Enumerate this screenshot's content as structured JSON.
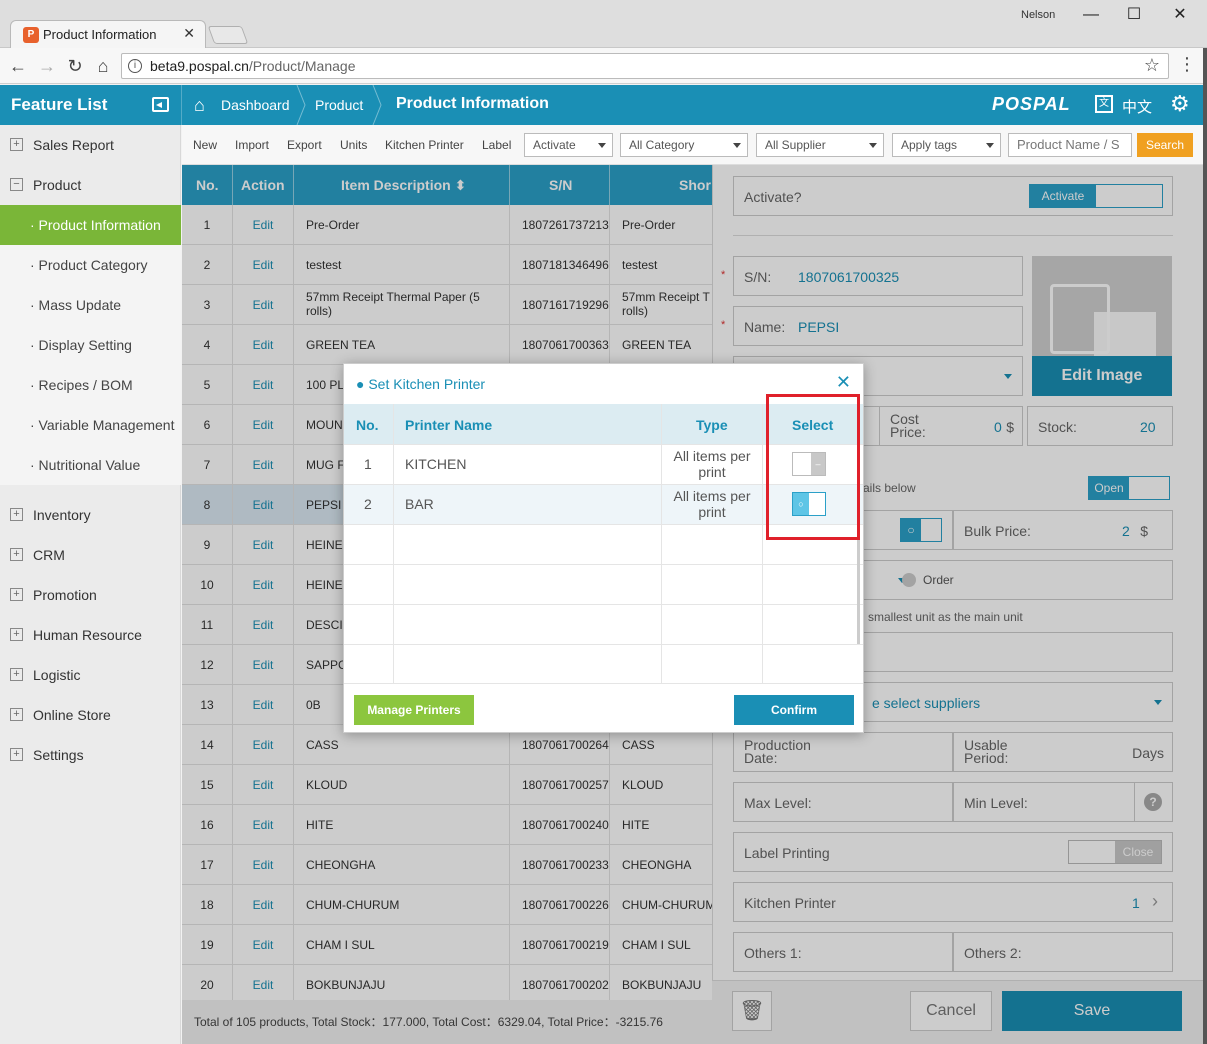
{
  "browser": {
    "tab_title": "Product Information",
    "user": "Nelson",
    "url_host": "beta9.pospal.cn",
    "url_path": "/Product/Manage"
  },
  "header": {
    "feature_list": "Feature List",
    "crumb_dashboard": "Dashboard",
    "crumb_product": "Product",
    "crumb_current": "Product Information",
    "brand": "POSPAL",
    "lang": "中文"
  },
  "sidebar": {
    "items": [
      {
        "label": "Sales Report",
        "mark": "+"
      },
      {
        "label": "Product",
        "mark": "−"
      },
      {
        "label": "Inventory",
        "mark": "+"
      },
      {
        "label": "CRM",
        "mark": "+"
      },
      {
        "label": "Promotion",
        "mark": "+"
      },
      {
        "label": "Human Resource",
        "mark": "+"
      },
      {
        "label": "Logistic",
        "mark": "+"
      },
      {
        "label": "Online Store",
        "mark": "+"
      },
      {
        "label": "Settings",
        "mark": "+"
      }
    ],
    "sub_items": [
      "· Product Information",
      "· Product Category",
      "· Mass Update",
      "· Display Setting",
      "· Recipes / BOM",
      "· Variable Management",
      "· Nutritional Value"
    ]
  },
  "toolbar": {
    "links": [
      "New",
      "Import",
      "Export",
      "Units",
      "Kitchen Printer",
      "Label"
    ],
    "activate_select": "Activate",
    "category_select": "All Category",
    "supplier_select": "All Supplier",
    "tags_select": "Apply tags",
    "search_placeholder": "Product Name / S",
    "search_button": "Search"
  },
  "table": {
    "headers": {
      "no": "No.",
      "action": "Action",
      "desc": "Item Description ⬍",
      "sn": "S/N",
      "short": "Shor"
    },
    "rows": [
      {
        "no": "1",
        "action": "Edit",
        "desc": "Pre-Order",
        "sn": "1807261737213",
        "short": "Pre-Order"
      },
      {
        "no": "2",
        "action": "Edit",
        "desc": "testest",
        "sn": "1807181346496",
        "short": "testest"
      },
      {
        "no": "3",
        "action": "Edit",
        "desc": "57mm Receipt Thermal Paper (5 rolls)",
        "sn": "1807161719296",
        "short": "57mm Receipt T rolls)"
      },
      {
        "no": "4",
        "action": "Edit",
        "desc": "GREEN TEA",
        "sn": "1807061700363",
        "short": "GREEN TEA"
      },
      {
        "no": "5",
        "action": "Edit",
        "desc": "100 PL",
        "sn": "",
        "short": ""
      },
      {
        "no": "6",
        "action": "Edit",
        "desc": "MOUN",
        "sn": "",
        "short": ""
      },
      {
        "no": "7",
        "action": "Edit",
        "desc": "MUG F",
        "sn": "",
        "short": ""
      },
      {
        "no": "8",
        "action": "Edit",
        "desc": "PEPSI",
        "sn": "",
        "short": ""
      },
      {
        "no": "9",
        "action": "Edit",
        "desc": "HEINE",
        "sn": "",
        "short": ""
      },
      {
        "no": "10",
        "action": "Edit",
        "desc": "HEINE",
        "sn": "",
        "short": ""
      },
      {
        "no": "11",
        "action": "Edit",
        "desc": "DESCI",
        "sn": "",
        "short": ""
      },
      {
        "no": "12",
        "action": "Edit",
        "desc": "SAPPC",
        "sn": "",
        "short": ""
      },
      {
        "no": "13",
        "action": "Edit",
        "desc": "0B",
        "sn": "",
        "short": ""
      },
      {
        "no": "14",
        "action": "Edit",
        "desc": "CASS",
        "sn": "1807061700264",
        "short": "CASS"
      },
      {
        "no": "15",
        "action": "Edit",
        "desc": "KLOUD",
        "sn": "1807061700257",
        "short": "KLOUD"
      },
      {
        "no": "16",
        "action": "Edit",
        "desc": "HITE",
        "sn": "1807061700240",
        "short": "HITE"
      },
      {
        "no": "17",
        "action": "Edit",
        "desc": "CHEONGHA",
        "sn": "1807061700233",
        "short": "CHEONGHA"
      },
      {
        "no": "18",
        "action": "Edit",
        "desc": "CHUM-CHURUM",
        "sn": "1807061700226",
        "short": "CHUM-CHURUM"
      },
      {
        "no": "19",
        "action": "Edit",
        "desc": "CHAM I SUL",
        "sn": "1807061700219",
        "short": "CHAM I SUL"
      },
      {
        "no": "20",
        "action": "Edit",
        "desc": "BOKBUNJAJU",
        "sn": "1807061700202",
        "short": "BOKBUNJAJU"
      }
    ],
    "footer": "Total of 105 products, Total Stock：177.000, Total Cost：6329.04, Total Price：-3215.76"
  },
  "form": {
    "activate_label": "Activate?",
    "activate_toggle": "Activate",
    "sn_label": "S/N:",
    "sn_value": "1807061700325",
    "name_label": "Name:",
    "name_value": "PEPSI",
    "edit_image": "Edit Image",
    "cost_label": "Cost Price:",
    "cost_value": "0",
    "currency": "$",
    "stock_label": "Stock:",
    "stock_value": "20",
    "details_text": "ails below",
    "open_toggle": "Open",
    "bulk_label": "Bulk Price:",
    "bulk_value": "2",
    "order_label": "Order",
    "unit_note": "smallest unit as the main unit",
    "supplier_text": "e select suppliers",
    "production_label": "Production Date:",
    "usable_label": "Usable Period:",
    "days": "Days",
    "max_label": "Max Level:",
    "min_label": "Min Level:",
    "label_printing": "Label Printing",
    "close_toggle": "Close",
    "kitchen_printer": "Kitchen Printer",
    "kitchen_printer_value": "1",
    "others1": "Others 1:",
    "others2": "Others 2:",
    "cancel": "Cancel",
    "save": "Save"
  },
  "modal": {
    "title": "● Set Kitchen Printer",
    "headers": {
      "no": "No.",
      "name": "Printer Name",
      "type": "Type",
      "select": "Select"
    },
    "rows": [
      {
        "no": "1",
        "name": "KITCHEN",
        "type": "All items per print",
        "selected": false
      },
      {
        "no": "2",
        "name": "BAR",
        "type": "All items per print",
        "selected": true
      }
    ],
    "manage_printers": "Manage Printers",
    "confirm": "Confirm"
  },
  "colors": {
    "primary": "#1a8fb5",
    "table_header": "#2ba0c8",
    "active_green": "#7ab638",
    "search_orange": "#f0a020",
    "highlight_red": "#e0202a"
  }
}
